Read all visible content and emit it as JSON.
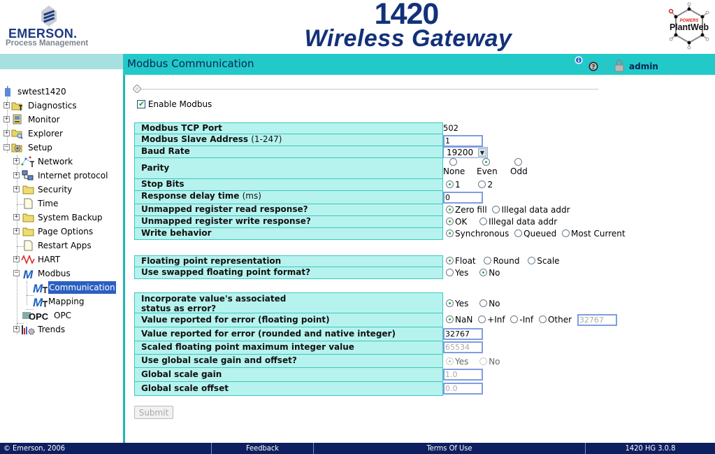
{
  "header": {
    "company": "EMERSON.",
    "company_sub": "Process Management",
    "product_number": "1420",
    "product_name": "Wireless Gateway",
    "partner_logo": "PlantWeb",
    "partner_logo_tag": "POWERS"
  },
  "titlebar": {
    "title": "Modbus Communication",
    "user": "admin",
    "icons": [
      "info-icon",
      "help-icon",
      "lock-icon"
    ]
  },
  "sidebar": {
    "root": "swtest1420",
    "items": [
      {
        "label": "Diagnostics",
        "icon": "diagnostics-folder-icon",
        "expander": "+"
      },
      {
        "label": "Monitor",
        "icon": "monitor-icon",
        "expander": "+"
      },
      {
        "label": "Explorer",
        "icon": "explorer-icon",
        "expander": "+"
      },
      {
        "label": "Setup",
        "icon": "setup-gear-icon",
        "expander": "-"
      },
      {
        "label": "Network",
        "icon": "network-icon",
        "expander": "+"
      },
      {
        "label": "Internet protocol",
        "icon": "internet-protocol-icon",
        "expander": "+"
      },
      {
        "label": "Security",
        "icon": "folder-icon",
        "expander": "+"
      },
      {
        "label": "Time",
        "icon": "page-icon",
        "expander": ""
      },
      {
        "label": "System Backup",
        "icon": "folder-icon",
        "expander": "+"
      },
      {
        "label": "Page Options",
        "icon": "folder-icon",
        "expander": "+"
      },
      {
        "label": "Restart Apps",
        "icon": "page-icon",
        "expander": ""
      },
      {
        "label": "HART",
        "icon": "hart-icon",
        "expander": "+"
      },
      {
        "label": "Modbus",
        "icon": "modbus-icon",
        "expander": "-"
      },
      {
        "label": "Communication",
        "icon": "modbus-tool-icon",
        "expander": "",
        "selected": true
      },
      {
        "label": "Mapping",
        "icon": "modbus-tool-icon",
        "expander": ""
      },
      {
        "label": "OPC",
        "icon": "opc-icon",
        "expander": ""
      },
      {
        "label": "Trends",
        "icon": "trends-icon",
        "expander": "+"
      }
    ]
  },
  "form": {
    "enable_modbus": {
      "label": "Enable Modbus",
      "checked": true
    },
    "tcp_port": {
      "label": "Modbus TCP Port",
      "value": "502"
    },
    "slave_address": {
      "label": "Modbus Slave Address",
      "unit": "(1-247)",
      "value": "1"
    },
    "baud_rate": {
      "label": "Baud Rate",
      "value": "19200"
    },
    "parity": {
      "label": "Parity",
      "options": [
        "None",
        "Even",
        "Odd"
      ],
      "selected": "Even"
    },
    "stop_bits": {
      "label": "Stop Bits",
      "options": [
        "1",
        "2"
      ],
      "selected": "1"
    },
    "response_delay": {
      "label": "Response delay time",
      "unit": "(ms)",
      "value": "0"
    },
    "unmapped_read": {
      "label": "Unmapped register read response?",
      "options": [
        "Zero fill",
        "Illegal data addr"
      ],
      "selected": "Zero fill"
    },
    "unmapped_write": {
      "label": "Unmapped register write response?",
      "options": [
        "OK",
        "Illegal data addr"
      ],
      "selected": "OK"
    },
    "write_behavior": {
      "label": "Write behavior",
      "options": [
        "Synchronous",
        "Queued",
        "Most Current"
      ],
      "selected": "Synchronous"
    },
    "float_repr": {
      "label": "Floating point representation",
      "options": [
        "Float",
        "Round",
        "Scale"
      ],
      "selected": "Float"
    },
    "swapped_float": {
      "label": "Use swapped floating point format?",
      "options": [
        "Yes",
        "No"
      ],
      "selected": "No"
    },
    "status_as_error": {
      "label_line1": "Incorporate value's associated",
      "label_line2": "status as error?",
      "options": [
        "Yes",
        "No"
      ],
      "selected": "Yes"
    },
    "error_float": {
      "label": "Value reported for error (floating point)",
      "options": [
        "NaN",
        "+Inf",
        "-Inf",
        "Other"
      ],
      "selected": "NaN",
      "other_value": "32767"
    },
    "error_int": {
      "label": "Value reported for error (rounded and native integer)",
      "value": "32767"
    },
    "scaled_max": {
      "label": "Scaled floating point maximum integer value",
      "value": "65534"
    },
    "global_scale": {
      "label": "Use global scale gain and offset?",
      "options": [
        "Yes",
        "No"
      ],
      "selected": "Yes"
    },
    "scale_gain": {
      "label": "Global scale gain",
      "value": "1.0"
    },
    "scale_offset": {
      "label": "Global scale offset",
      "value": "0.0"
    },
    "submit_label": "Submit"
  },
  "footer": {
    "copyright": "© Emerson, 2006",
    "feedback": "Feedback",
    "terms": "Terms Of Use",
    "version": "1420 HG 3.0.8"
  },
  "colors": {
    "brand_navy": "#13317a",
    "title_bar": "#22c9c9",
    "label_cell": "#b6f3ee",
    "footer": "#0d1f5f",
    "selection": "#2b5fc1"
  }
}
